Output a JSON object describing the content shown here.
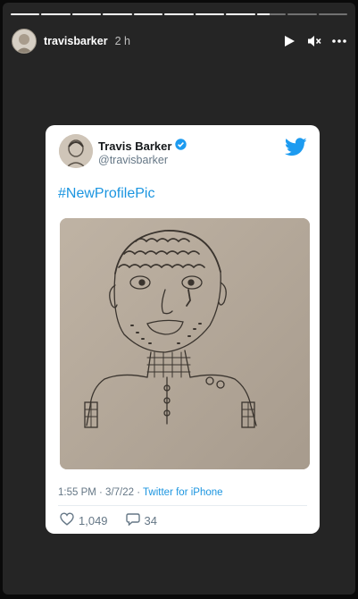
{
  "story": {
    "progress": [
      1,
      1,
      1,
      1,
      1,
      1,
      1,
      1,
      0.45,
      0,
      0
    ],
    "username": "travisbarker",
    "time": "2 h",
    "icons": [
      "play-icon",
      "mute-icon",
      "more-icon"
    ]
  },
  "tweet": {
    "name": "Travis Barker",
    "handle": "@travisbarker",
    "text": "#NewProfilePic",
    "timestamp": "1:55 PM · 3/7/22 · ",
    "source": "Twitter for iPhone",
    "likes": "1,049",
    "replies": "34",
    "accent": "#1b95e0"
  }
}
